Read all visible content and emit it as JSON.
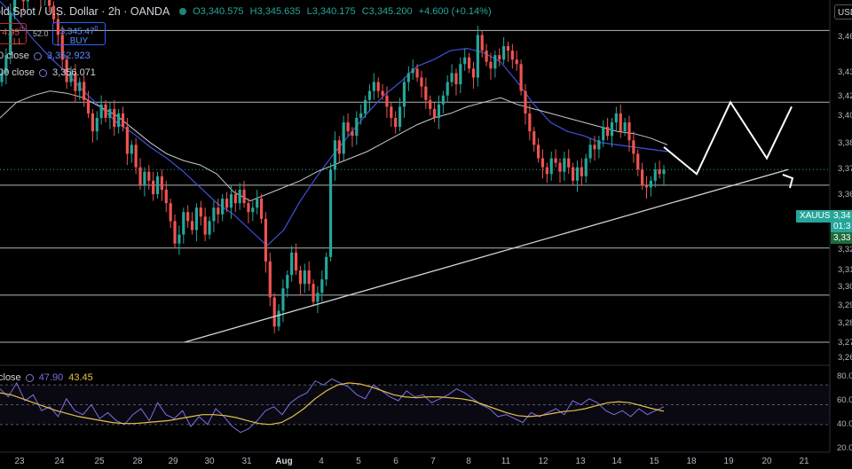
{
  "header": {
    "title": "old Spot / U.S. Dollar · 2h · OANDA",
    "open": "O3,340.575",
    "high": "H3,345.635",
    "low": "L3,340.175",
    "close": "C3,345.200",
    "change": "+4.600 (+0.14%)"
  },
  "trade": {
    "sell_price": "4.95",
    "sell_sup": "0",
    "sell_label": "LL",
    "spread": "52.0",
    "buy_price": "3,345.47",
    "buy_sup": "0",
    "buy_label": "BUY"
  },
  "indicators": {
    "ma1_label": "0 close",
    "ma1_value": "3,352.923",
    "ma2_label": "00 close",
    "ma2_value": "3,356.071",
    "rsi_label": "close",
    "rsi_value": "47.90",
    "rsi_ma_value": "43.45"
  },
  "price_axis": {
    "currency": "USD",
    "labels": [
      "3,46",
      "3,43",
      "3,42",
      "3,40",
      "3,38",
      "3,37",
      "3,36",
      "3,34",
      "3,33",
      "3,32",
      "3,31",
      "3,30",
      "3,29",
      "3,28",
      "3,27",
      "3,26",
      "3,25"
    ],
    "symbol_tag": "XAUUSD",
    "last_price": "3,34",
    "countdown": "01:3",
    "level_tag": "3,33"
  },
  "rsi_axis": [
    "80.0",
    "60.0",
    "40.0",
    "20.0"
  ],
  "time_axis": [
    "23",
    "24",
    "25",
    "28",
    "29",
    "30",
    "31",
    "Aug",
    "4",
    "5",
    "6",
    "7",
    "8",
    "11",
    "12",
    "13",
    "14",
    "15",
    "18",
    "19",
    "20",
    "21"
  ],
  "colors": {
    "background": "#000000",
    "up": "#26a69a",
    "down": "#ef5350",
    "ma_fast": "#3f51d8",
    "ma_slow": "#c8c8c8",
    "rsi": "#7b6ee0",
    "rsi_ma": "#e6c14a",
    "support_lines": "#d1d4dc"
  },
  "chart_data": [
    {
      "type": "line",
      "title": "Gold Spot / U.S. Dollar · 2h · OANDA",
      "xlabel": "",
      "ylabel": "",
      "x_range_dates": [
        "Jul 23",
        "Aug 21"
      ],
      "ylim": [
        3245,
        3465
      ],
      "y_tick_labels": [
        "3,46",
        "3,43",
        "3,42",
        "3,40",
        "3,38",
        "3,37",
        "3,36",
        "3,34",
        "3,33",
        "3,32",
        "3,31",
        "3,30",
        "3,29",
        "3,28",
        "3,27",
        "3,26",
        "3,25"
      ],
      "x_tick_labels": [
        "23",
        "24",
        "25",
        "28",
        "29",
        "30",
        "31",
        "Aug",
        "4",
        "5",
        "6",
        "7",
        "8",
        "11",
        "12",
        "13",
        "14",
        "15",
        "18",
        "19",
        "20",
        "21"
      ],
      "grid": false,
      "horizontal_levels": [
        3435,
        3407,
        3375,
        3338,
        3310,
        3289,
        3268
      ],
      "trendline": [
        [
          "Jul 29",
          3268
        ],
        [
          "Aug 20",
          3345
        ]
      ],
      "projection_path": [
        [
          "Aug 15",
          3355
        ],
        [
          "Aug 18",
          3343
        ],
        [
          "Aug 19",
          3375
        ],
        [
          "Aug 20",
          3350
        ],
        [
          "Aug 20",
          3373
        ]
      ],
      "series": [
        {
          "name": "XAUUSD",
          "candle_closes": [
            3388,
            3396,
            3415,
            3432,
            3428,
            3420,
            3426,
            3433,
            3430,
            3422,
            3428,
            3418,
            3412,
            3405,
            3394,
            3384,
            3388,
            3380,
            3384,
            3376,
            3370,
            3362,
            3368,
            3374,
            3368,
            3372,
            3364,
            3370,
            3364,
            3352,
            3356,
            3346,
            3338,
            3344,
            3340,
            3334,
            3342,
            3336,
            3330,
            3322,
            3312,
            3316,
            3326,
            3322,
            3318,
            3328,
            3324,
            3316,
            3322,
            3328,
            3325,
            3332,
            3328,
            3334,
            3330,
            3336,
            3330,
            3326,
            3328,
            3332,
            3323,
            3304,
            3288,
            3275,
            3282,
            3292,
            3298,
            3308,
            3300,
            3294,
            3300,
            3294,
            3286,
            3290,
            3296,
            3306,
            3345,
            3358,
            3352,
            3366,
            3362,
            3360,
            3368,
            3370,
            3376,
            3380,
            3384,
            3380,
            3378,
            3373,
            3368,
            3364,
            3373,
            3384,
            3388,
            3390,
            3386,
            3382,
            3376,
            3372,
            3368,
            3374,
            3378,
            3384,
            3388,
            3383,
            3392,
            3395,
            3390,
            3386,
            3405,
            3398,
            3393,
            3390,
            3396,
            3394,
            3400,
            3398,
            3394,
            3392,
            3380,
            3370,
            3362,
            3356,
            3350,
            3346,
            3343,
            3350,
            3348,
            3344,
            3350,
            3346,
            3340,
            3346,
            3342,
            3350,
            3356,
            3354,
            3358,
            3364,
            3360,
            3366,
            3370,
            3362,
            3366,
            3358,
            3352,
            3345,
            3338,
            3337,
            3340,
            3345,
            3343,
            3345
          ]
        },
        {
          "name": "MA fast",
          "values": [
            3420,
            3412,
            3403,
            3395,
            3388,
            3380,
            3373,
            3366,
            3361,
            3355,
            3350,
            3344,
            3337,
            3330,
            3325,
            3318,
            3311,
            3318,
            3331,
            3342,
            3352,
            3361,
            3370,
            3378,
            3384,
            3391,
            3394,
            3398,
            3399,
            3397,
            3393,
            3384,
            3374,
            3366,
            3362,
            3360,
            3357,
            3356,
            3355,
            3354,
            3353
          ]
        },
        {
          "name": "MA slow",
          "values": [
            3368,
            3375,
            3378,
            3380,
            3379,
            3377,
            3373,
            3369,
            3363,
            3357,
            3352,
            3349,
            3347,
            3343,
            3335,
            3331,
            3334,
            3337,
            3340,
            3344,
            3347,
            3350,
            3353,
            3357,
            3361,
            3365,
            3368,
            3370,
            3373,
            3375,
            3377,
            3374,
            3372,
            3370,
            3368,
            3366,
            3364,
            3362,
            3361,
            3359,
            3356
          ]
        }
      ]
    },
    {
      "type": "line",
      "title": "RSI",
      "ylim": [
        20,
        80
      ],
      "y_tick_labels": [
        "80.0",
        "60.0",
        "40.0",
        "20.0"
      ],
      "levels": [
        70,
        50,
        30
      ],
      "series": [
        {
          "name": "RSI",
          "values": [
            66,
            58,
            72,
            54,
            60,
            44,
            48,
            38,
            56,
            44,
            40,
            50,
            36,
            42,
            34,
            30,
            40,
            46,
            34,
            52,
            40,
            36,
            44,
            28,
            38,
            30,
            46,
            38,
            28,
            22,
            26,
            34,
            44,
            48,
            40,
            52,
            58,
            62,
            74,
            70,
            76,
            72,
            68,
            60,
            56,
            70,
            64,
            58,
            54,
            64,
            58,
            60,
            52,
            56,
            60,
            66,
            62,
            56,
            50,
            46,
            38,
            40,
            36,
            32,
            42,
            38,
            42,
            46,
            40,
            54,
            50,
            56,
            52,
            44,
            40,
            44,
            38,
            46,
            40,
            44,
            47.9
          ]
        },
        {
          "name": "RSI MA",
          "values": [
            62,
            60,
            56,
            52,
            48,
            44,
            41,
            38,
            36,
            34,
            32,
            31,
            31,
            32,
            33,
            34,
            36,
            38,
            40,
            40,
            39,
            37,
            34,
            31,
            30,
            32,
            38,
            46,
            56,
            64,
            70,
            72,
            71,
            68,
            64,
            60,
            58,
            57,
            58,
            58,
            57,
            56,
            54,
            50,
            46,
            42,
            39,
            38,
            39,
            41,
            43,
            44,
            46,
            49,
            52,
            53,
            52,
            49,
            46,
            43.45
          ]
        }
      ]
    }
  ]
}
